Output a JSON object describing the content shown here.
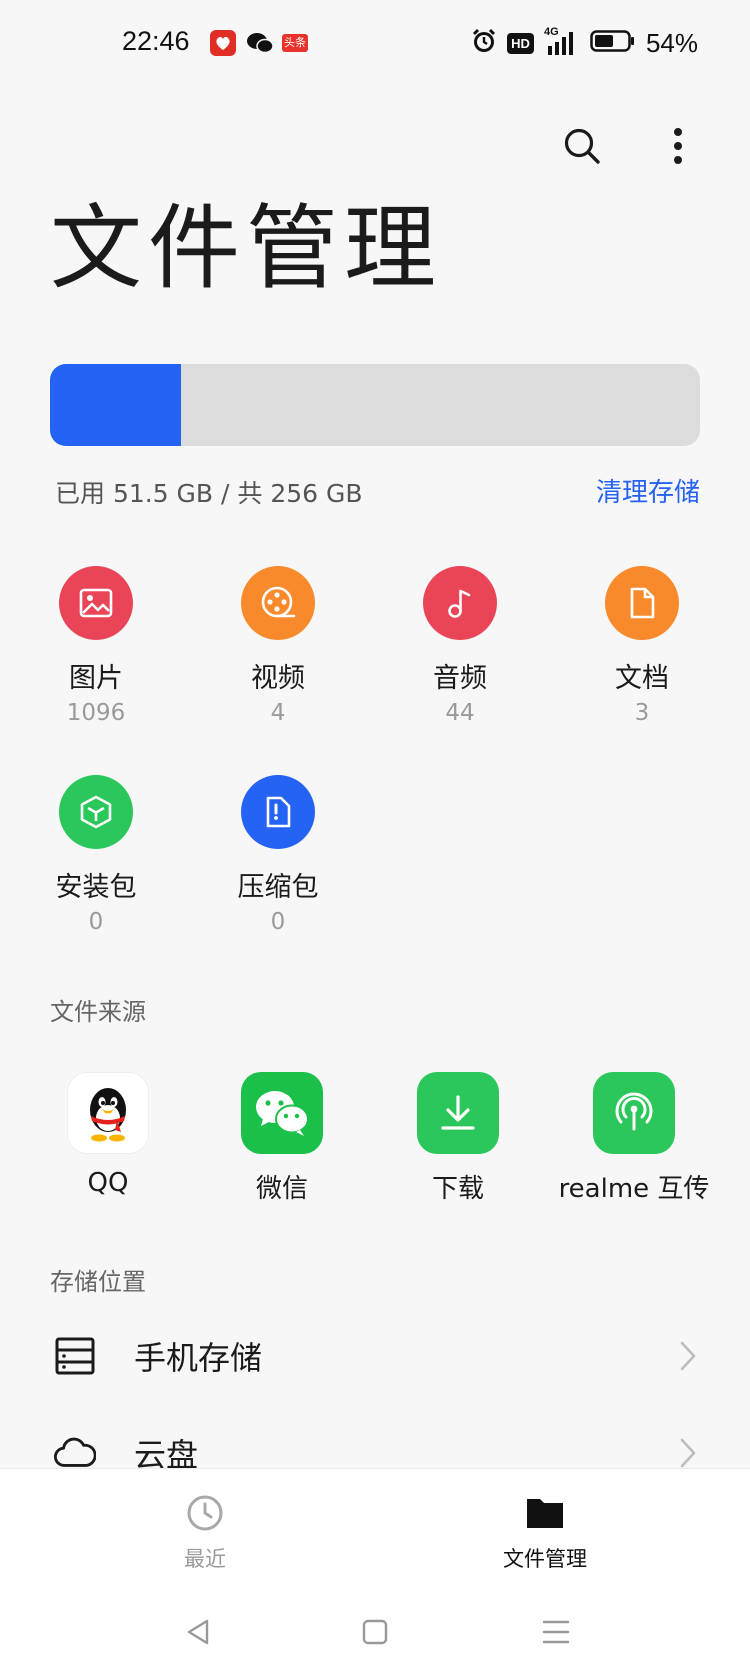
{
  "status_bar": {
    "time": "22:46",
    "toutiao_badge": "头条",
    "battery": "54%",
    "network": "4G",
    "hd": "HD"
  },
  "header": {
    "title": "文件管理",
    "actions": [
      "search-icon",
      "more-icon"
    ]
  },
  "storage": {
    "used_fraction": 0.201,
    "summary": "已用 51.5 GB / 共 256 GB",
    "clean_label": "清理存储",
    "fill_color": "#2463f3"
  },
  "categories": [
    {
      "label": "图片",
      "count": "1096",
      "color": "#ea4557",
      "icon": "image-icon"
    },
    {
      "label": "视频",
      "count": "4",
      "color": "#f98a2c",
      "icon": "film-reel-icon"
    },
    {
      "label": "音频",
      "count": "44",
      "color": "#ea4557",
      "icon": "music-note-icon"
    },
    {
      "label": "文档",
      "count": "3",
      "color": "#f98a2c",
      "icon": "document-icon"
    },
    {
      "label": "安装包",
      "count": "0",
      "color": "#2bc75a",
      "icon": "package-icon"
    },
    {
      "label": "压缩包",
      "count": "0",
      "color": "#2463f3",
      "icon": "archive-icon"
    }
  ],
  "sources_section": {
    "title": "文件来源",
    "items": [
      {
        "label": "QQ",
        "icon": "qq-icon"
      },
      {
        "label": "微信",
        "icon": "wechat-icon"
      },
      {
        "label": "下载",
        "icon": "download-icon"
      },
      {
        "label": "realme 互传",
        "icon": "realme-share-icon"
      }
    ]
  },
  "storage_section": {
    "title": "存储位置",
    "items": [
      {
        "label": "手机存储",
        "icon": "phone-storage-icon"
      },
      {
        "label": "云盘",
        "icon": "cloud-icon"
      }
    ]
  },
  "bottom_nav": {
    "items": [
      {
        "label": "最近",
        "icon": "clock-icon",
        "active": false
      },
      {
        "label": "文件管理",
        "icon": "folder-icon",
        "active": true
      }
    ]
  }
}
